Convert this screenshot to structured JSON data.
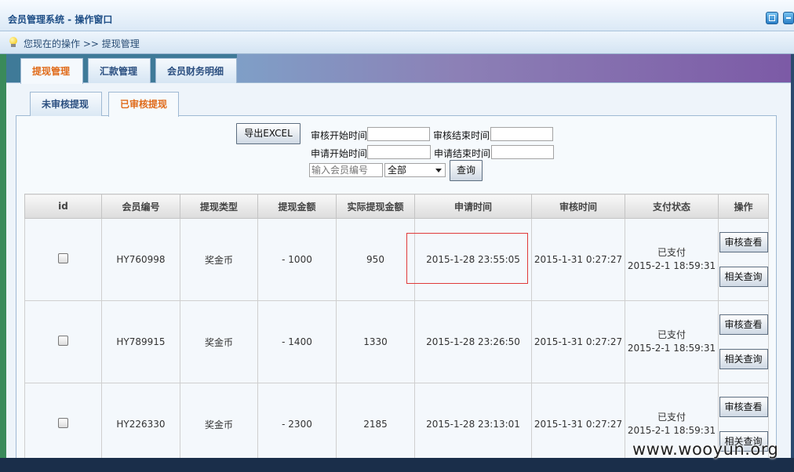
{
  "window": {
    "title": "会员管理系统 - 操作窗口"
  },
  "breadcrumb": {
    "icon": "lightbulb-icon",
    "text": "您现在的操作 >> 提现管理"
  },
  "main_tabs": [
    {
      "label": "提现管理",
      "active": true
    },
    {
      "label": "汇款管理",
      "active": false
    },
    {
      "label": "会员财务明细",
      "active": false
    }
  ],
  "sub_tabs": [
    {
      "label": "未审核提现",
      "active": false
    },
    {
      "label": "已审核提现",
      "active": true
    }
  ],
  "filters": {
    "export_label": "导出EXCEL",
    "audit_start_label": "审核开始时间",
    "audit_end_label": "审核结束时间",
    "apply_start_label": "申请开始时间",
    "apply_end_label": "申请结束时间",
    "member_no_placeholder": "输入会员编号",
    "select_value": "全部",
    "query_label": "查询"
  },
  "table": {
    "columns": [
      "id",
      "会员编号",
      "提现类型",
      "提现金额",
      "实际提现金额",
      "申请时间",
      "审核时间",
      "支付状态",
      "操作"
    ],
    "rows": [
      {
        "member_no": "HY760998",
        "type": "奖金币",
        "amount": "- 1000",
        "actual": "950",
        "apply_time": "2015-1-28 23:55:05",
        "audit_time": "2015-1-31 0:27:27",
        "status": "已支付",
        "paid_time": "2015-2-1 18:59:31"
      },
      {
        "member_no": "HY789915",
        "type": "奖金币",
        "amount": "- 1400",
        "actual": "1330",
        "apply_time": "2015-1-28 23:26:50",
        "audit_time": "2015-1-31 0:27:27",
        "status": "已支付",
        "paid_time": "2015-2-1 18:59:31"
      },
      {
        "member_no": "HY226330",
        "type": "奖金币",
        "amount": "- 2300",
        "actual": "2185",
        "apply_time": "2015-1-28 23:13:01",
        "audit_time": "2015-1-31 0:27:27",
        "status": "已支付",
        "paid_time": "2015-2-1 18:59:31"
      }
    ],
    "action_view": "审核查看",
    "action_related": "相关查询"
  },
  "watermark": "www.wooyun.org",
  "colors": {
    "active_tab": "#e06b1a",
    "highlight_box": "#e03a3a",
    "title_text": "#1e4e86"
  }
}
